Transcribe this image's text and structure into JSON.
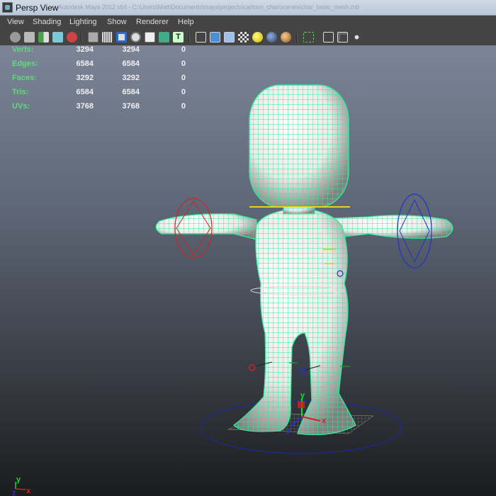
{
  "window": {
    "title": "Persp View",
    "subtitle": "Autodesk Maya 2012 x64 - C:\\Users\\Matt\\Documents\\maya\\projects\\cartoon_char\\scenes\\char_basic_mesh.mb"
  },
  "menu": {
    "items": [
      "View",
      "Shading",
      "Lighting",
      "Show",
      "Renderer",
      "Help"
    ]
  },
  "hud": {
    "rows": [
      {
        "label": "Verts:",
        "c1": "3294",
        "c2": "3294",
        "c3": "0"
      },
      {
        "label": "Edges:",
        "c1": "6584",
        "c2": "6584",
        "c3": "0"
      },
      {
        "label": "Faces:",
        "c1": "3292",
        "c2": "3292",
        "c3": "0"
      },
      {
        "label": "Tris:",
        "c1": "6584",
        "c2": "6584",
        "c3": "0"
      },
      {
        "label": "UVs:",
        "c1": "3768",
        "c2": "3768",
        "c3": "0"
      }
    ]
  },
  "manipulator": {
    "y": "y",
    "x": "x",
    "z": "z"
  },
  "axis_gizmo": {
    "y": "y",
    "x": "x",
    "z": "z"
  },
  "colors": {
    "wire": "#33e89a",
    "rig_red": "#d22222",
    "rig_blue": "#1e33cc",
    "rig_yellow": "#e8d21a"
  }
}
